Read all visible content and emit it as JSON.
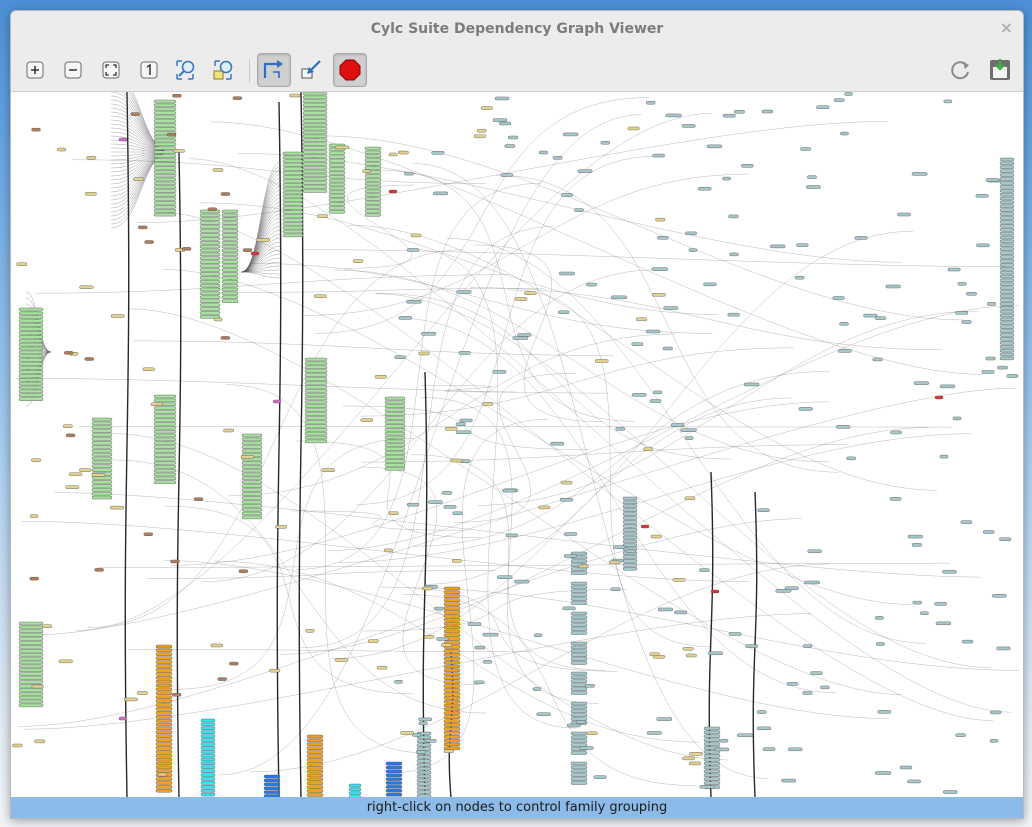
{
  "window": {
    "title": "Cylc Suite Dependency Graph Viewer",
    "close_glyph": "×"
  },
  "toolbar": {
    "buttons": [
      {
        "name": "zoom-in-button",
        "icon": "zoom-in-icon",
        "active": false
      },
      {
        "name": "zoom-out-button",
        "icon": "zoom-out-icon",
        "active": false
      },
      {
        "name": "zoom-fit-button",
        "icon": "zoom-fit-icon",
        "active": false
      },
      {
        "name": "zoom-normal-button",
        "icon": "zoom-normal-icon",
        "active": false
      },
      {
        "name": "group-families-button",
        "icon": "group-icon",
        "active": false
      },
      {
        "name": "ungroup-families-button",
        "icon": "ungroup-icon",
        "active": false
      },
      {
        "name": "landscape-toggle-button",
        "icon": "orientation-arrow-icon",
        "active": true
      },
      {
        "name": "ignore-suicide-button",
        "icon": "suicide-arrow-icon",
        "active": false
      },
      {
        "name": "stop-button",
        "icon": "stop-icon",
        "active": true
      },
      {
        "name": "refresh-button",
        "icon": "refresh-icon",
        "active": false
      },
      {
        "name": "save-image-button",
        "icon": "save-image-icon",
        "active": false
      }
    ]
  },
  "graph": {
    "node_colors": {
      "green": "#a8e0a0",
      "teal": "#a6c8cc",
      "khaki": "#e4d38f",
      "brown": "#b07e5a",
      "orange": "#f2a020",
      "cyan": "#38e2f0",
      "blue": "#2a79de",
      "red": "#e03434",
      "magenta": "#d070d0"
    },
    "edge_color": "#555555"
  },
  "status": {
    "message": "right-click on nodes to control family grouping"
  }
}
